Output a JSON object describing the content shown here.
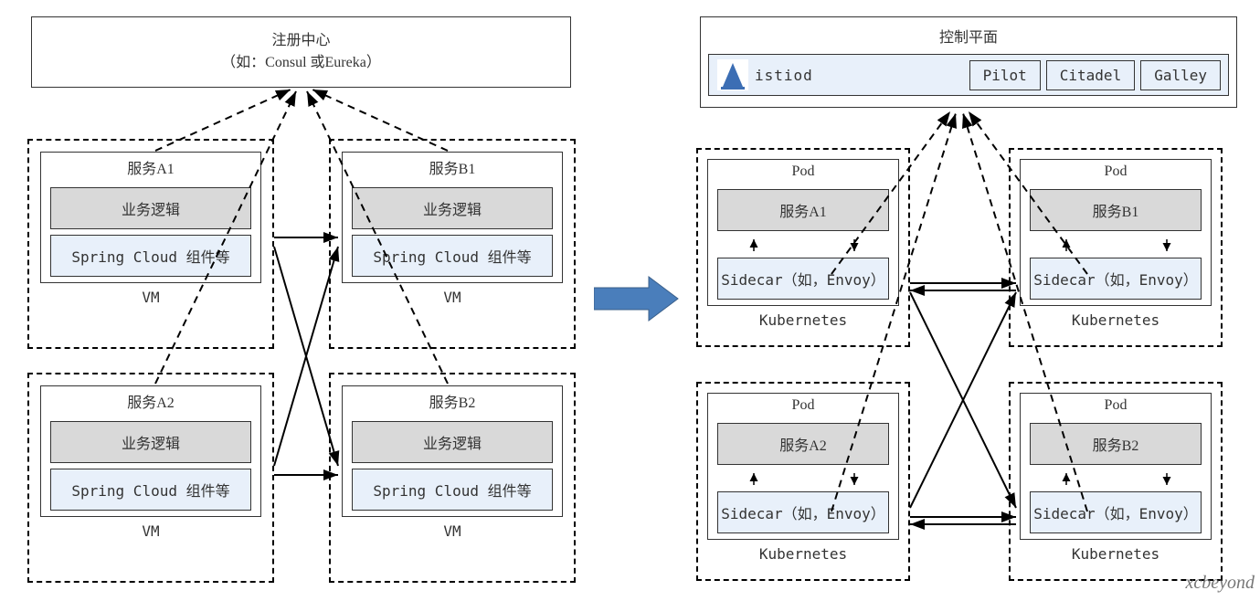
{
  "left": {
    "registry_title": "注册中心",
    "registry_subtitle": "（如：Consul 或Eureka）",
    "nodes": [
      {
        "title": "服务A1",
        "logic": "业务逻辑",
        "lib": "Spring Cloud 组件等",
        "footer": "VM"
      },
      {
        "title": "服务B1",
        "logic": "业务逻辑",
        "lib": "Spring Cloud 组件等",
        "footer": "VM"
      },
      {
        "title": "服务A2",
        "logic": "业务逻辑",
        "lib": "Spring Cloud 组件等",
        "footer": "VM"
      },
      {
        "title": "服务B2",
        "logic": "业务逻辑",
        "lib": "Spring Cloud 组件等",
        "footer": "VM"
      }
    ]
  },
  "right": {
    "control_plane_title": "控制平面",
    "istiod_label": "istiod",
    "components": [
      "Pilot",
      "Citadel",
      "Galley"
    ],
    "nodes": [
      {
        "title": "Pod",
        "svc": "服务A1",
        "sidecar": "Sidecar（如，Envoy）",
        "footer": "Kubernetes"
      },
      {
        "title": "Pod",
        "svc": "服务B1",
        "sidecar": "Sidecar（如，Envoy）",
        "footer": "Kubernetes"
      },
      {
        "title": "Pod",
        "svc": "服务A2",
        "sidecar": "Sidecar（如，Envoy）",
        "footer": "Kubernetes"
      },
      {
        "title": "Pod",
        "svc": "服务B2",
        "sidecar": "Sidecar（如，Envoy）",
        "footer": "Kubernetes"
      }
    ]
  },
  "watermark": "xcbeyond"
}
